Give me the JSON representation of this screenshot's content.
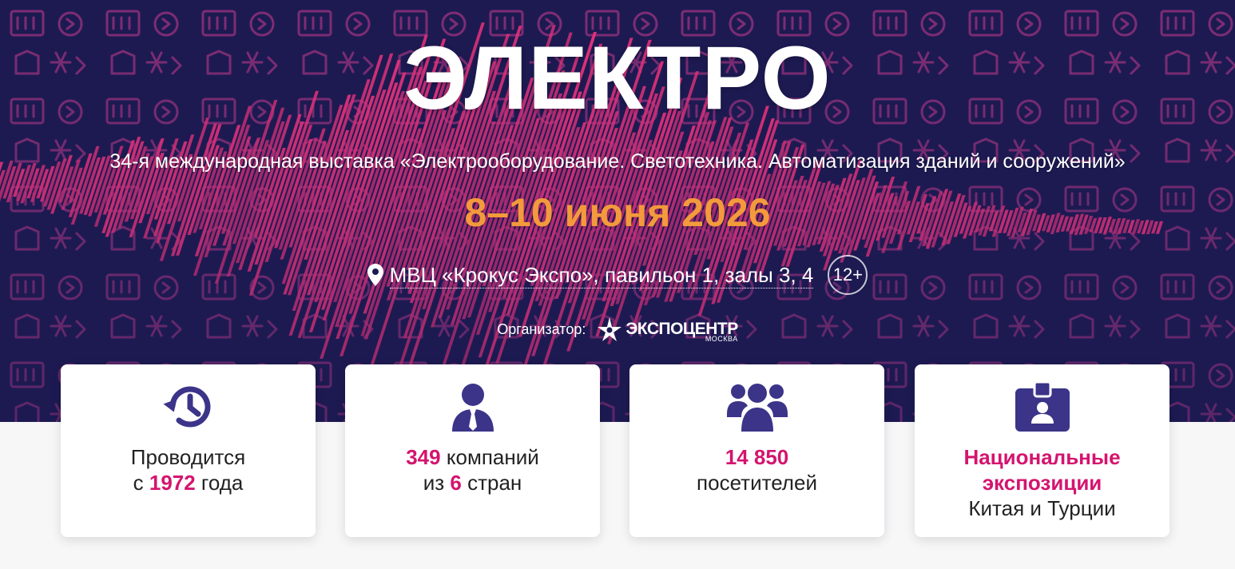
{
  "hero": {
    "title": "ЭЛЕКТРО",
    "subtitle": "34-я международная выставка «Электрооборудование. Светотехника. Автоматизация зданий и сооружений»",
    "dates": "8–10 июня 2026",
    "venue": "МВЦ «Крокус Экспо», павильон 1, залы 3, 4",
    "age_rating": "12+",
    "organizer_label": "Организатор:",
    "organizer_name": "ЭКСПОЦЕНТР",
    "organizer_city": "МОСКВА"
  },
  "colors": {
    "hero_bg": "#1d1a52",
    "wave": "#e8327a",
    "dates": "#f39a3c",
    "accent": "#d4146f",
    "icon": "#3b3489"
  },
  "stats": [
    {
      "icon": "history-icon",
      "line1": "Проводится",
      "line2_prefix": "с ",
      "line2_value": "1972",
      "line2_suffix": " года"
    },
    {
      "icon": "businessman-icon",
      "line1_value": "349",
      "line1_suffix": " компаний",
      "line2_prefix": "из ",
      "line2_value": "6",
      "line2_suffix": " стран"
    },
    {
      "icon": "group-icon",
      "line1_value": "14 850",
      "line2": "посетителей"
    },
    {
      "icon": "badge-icon",
      "line1": "Национальные",
      "line2": "экспозиции",
      "line3": "Китая и Турции"
    }
  ]
}
